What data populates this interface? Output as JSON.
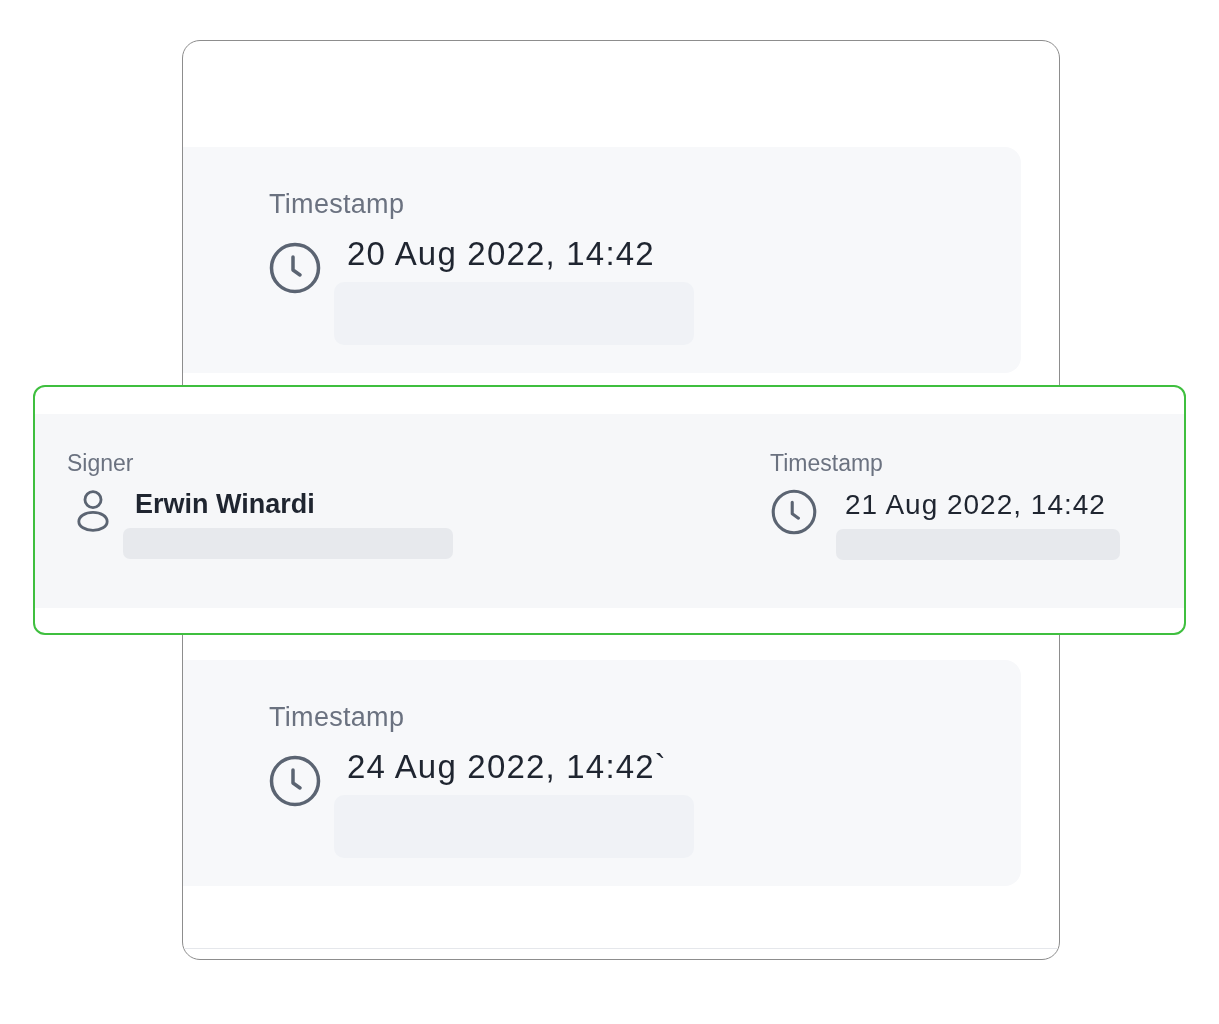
{
  "entries": [
    {
      "kind": "timestamp",
      "label": "Timestamp",
      "value": "20 Aug 2022, 14:42"
    },
    {
      "kind": "signer",
      "signer_label": "Signer",
      "signer_name": "Erwin Winardi",
      "timestamp_label": "Timestamp",
      "timestamp_value": "21 Aug 2022, 14:42"
    },
    {
      "kind": "timestamp",
      "label": "Timestamp",
      "value": "24 Aug 2022, 14:42`"
    }
  ]
}
